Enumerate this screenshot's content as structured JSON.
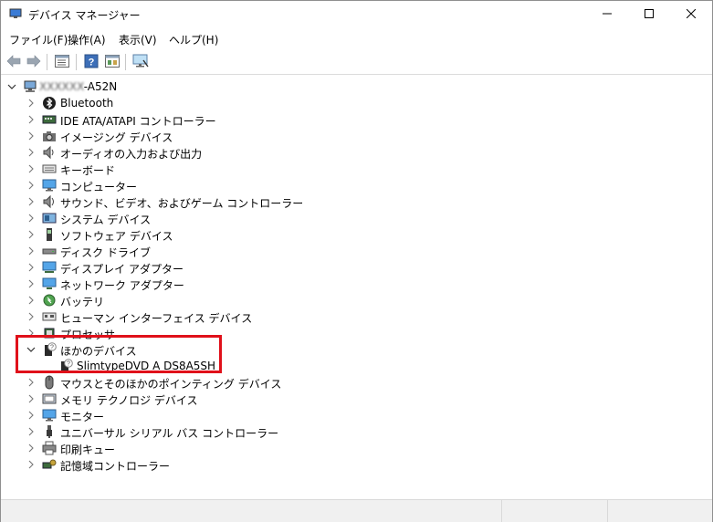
{
  "window": {
    "title": "デバイス マネージャー",
    "minimize_icon": "minimize-icon",
    "maximize_icon": "maximize-icon",
    "close_icon": "close-icon"
  },
  "menu": [
    "ファイル(F)",
    "操作(A)",
    "表示(V)",
    "ヘルプ(H)"
  ],
  "toolbar": {
    "buttons": [
      "back-arrow-icon",
      "forward-arrow-icon",
      "properties-icon",
      "help-icon",
      "view-icon",
      "monitor-scan-icon"
    ]
  },
  "tree": {
    "root": {
      "label_obscured": "XXXXXX",
      "label_suffix": "-A52N",
      "expanded": true
    },
    "categories": [
      {
        "label": "Bluetooth",
        "icon": "bluetooth-icon",
        "expanded": false
      },
      {
        "label": "IDE ATA/ATAPI コントローラー",
        "icon": "ide-controller-icon",
        "expanded": false
      },
      {
        "label": "イメージング デバイス",
        "icon": "camera-icon",
        "expanded": false
      },
      {
        "label": "オーディオの入力および出力",
        "icon": "speaker-icon",
        "expanded": false
      },
      {
        "label": "キーボード",
        "icon": "keyboard-icon",
        "expanded": false
      },
      {
        "label": "コンピューター",
        "icon": "computer-icon",
        "expanded": false
      },
      {
        "label": "サウンド、ビデオ、およびゲーム コントローラー",
        "icon": "sound-icon",
        "expanded": false
      },
      {
        "label": "システム デバイス",
        "icon": "system-device-icon",
        "expanded": false
      },
      {
        "label": "ソフトウェア デバイス",
        "icon": "software-device-icon",
        "expanded": false
      },
      {
        "label": "ディスク ドライブ",
        "icon": "disk-drive-icon",
        "expanded": false
      },
      {
        "label": "ディスプレイ アダプター",
        "icon": "display-adapter-icon",
        "expanded": false
      },
      {
        "label": "ネットワーク アダプター",
        "icon": "network-adapter-icon",
        "expanded": false
      },
      {
        "label": "バッテリ",
        "icon": "battery-icon",
        "expanded": false
      },
      {
        "label": "ヒューマン インターフェイス デバイス",
        "icon": "hid-icon",
        "expanded": false
      },
      {
        "label": "プロセッサ",
        "icon": "processor-icon",
        "expanded": false
      },
      {
        "label": "ほかのデバイス",
        "icon": "unknown-device-icon",
        "expanded": true
      },
      {
        "label": "SlimtypeDVD A  DS8A5SH",
        "icon": "unknown-device-icon",
        "child": true
      },
      {
        "label": "マウスとそのほかのポインティング デバイス",
        "icon": "mouse-icon",
        "expanded": false
      },
      {
        "label": "メモリ テクノロジ デバイス",
        "icon": "memory-icon",
        "expanded": false
      },
      {
        "label": "モニター",
        "icon": "monitor-icon",
        "expanded": false
      },
      {
        "label": "ユニバーサル シリアル バス コントローラー",
        "icon": "usb-icon",
        "expanded": false
      },
      {
        "label": "印刷キュー",
        "icon": "printer-icon",
        "expanded": false
      },
      {
        "label": "記憶域コントローラー",
        "icon": "storage-controller-icon",
        "expanded": false
      }
    ]
  },
  "colors": {
    "highlight": "#e0101a",
    "accent_blue": "#1e6fd0"
  }
}
